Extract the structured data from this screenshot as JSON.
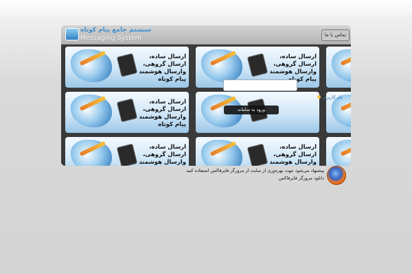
{
  "header": {
    "logo_persian": "سیستم جامع پیام کوتاه",
    "logo_english": "Messaging System",
    "nav_button": "تماس با ما"
  },
  "banner": {
    "text": "ارسال ساده، ارسال گروهی، وارسال هوشمند پیام کوتاه"
  },
  "login": {
    "user_label": "نام کاربری :",
    "tooltip": "ورود به سامانه"
  },
  "browser_notice": {
    "line1": "پیشنهاد می‌شود جهت بهره‌وری از سایت از مرورگر فایرفاکس استفاده کنید",
    "line2": "دانلود مرورگر فایرفاکس"
  },
  "icons": {
    "logo": "message-app-icon",
    "browser": "firefox-icon"
  },
  "colors": {
    "background": "#d4d4d4",
    "frame": "#a9a9a9",
    "accent": "#3b8fd0"
  }
}
